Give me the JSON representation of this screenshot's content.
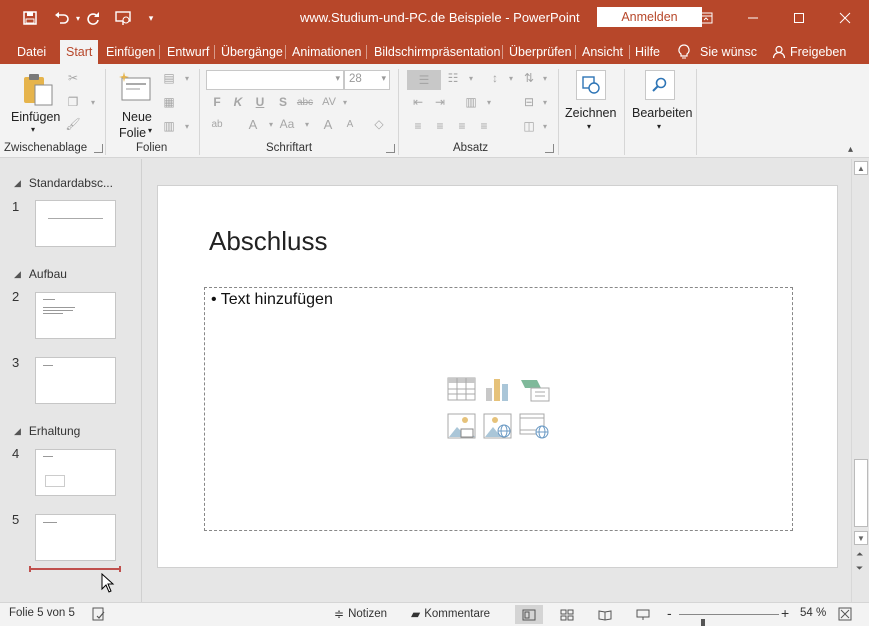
{
  "titlebar": {
    "title": "www.Studium-und-PC.de  Beispiele  -  PowerPoint",
    "signin": "Anmelden",
    "qat": [
      "save-icon",
      "undo-icon",
      "redo-icon",
      "start-slideshow-icon",
      "customize-qat-icon"
    ],
    "accent": "#b7472a"
  },
  "tabs": [
    {
      "label": "Datei"
    },
    {
      "label": "Start",
      "active": true
    },
    {
      "label": "Einfügen"
    },
    {
      "label": "Entwurf"
    },
    {
      "label": "Übergänge"
    },
    {
      "label": "Animationen"
    },
    {
      "label": "Bildschirmpräsentation"
    },
    {
      "label": "Überprüfen"
    },
    {
      "label": "Ansicht"
    },
    {
      "label": "Hilfe"
    }
  ],
  "tell_me": "Sie wünsc",
  "share": "Freigeben",
  "ribbon": {
    "clipboard": {
      "label": "Zwischenablage",
      "paste": "Einfügen"
    },
    "slides": {
      "label": "Folien",
      "new_slide_1": "Neue",
      "new_slide_2": "Folie"
    },
    "font": {
      "label": "Schriftart",
      "font_size": "28"
    },
    "paragraph": {
      "label": "Absatz"
    },
    "drawing": {
      "label": "Zeichnen"
    },
    "editing": {
      "label": "Bearbeiten"
    }
  },
  "thumbs": {
    "sections": [
      {
        "name": "Standardabsc..."
      },
      {
        "name": "Aufbau"
      },
      {
        "name": "Erhaltung"
      }
    ],
    "slides": [
      "1",
      "2",
      "3",
      "4",
      "5"
    ]
  },
  "slide": {
    "title": "Abschluss",
    "bullet": "• Text hinzufügen"
  },
  "status": {
    "slide_info": "Folie 5 von 5",
    "notes": "Notizen",
    "comments": "Kommentare",
    "zoom_minus": "-",
    "zoom_plus": "+",
    "zoom": "54 %",
    "zoom_level": 0.54
  }
}
